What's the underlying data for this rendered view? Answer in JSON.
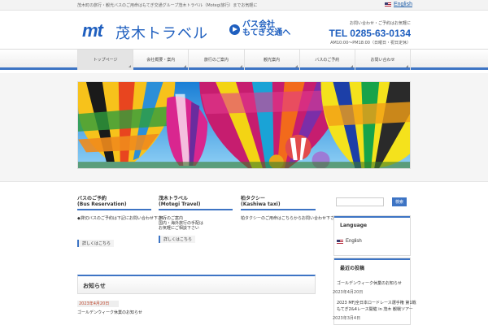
{
  "topbar": {
    "tagline": "茂木町の旅行・観光バスのご用命はもてぎ交通グループ茂木トラベル（Motegi旅行）までお気軽に",
    "language_label": "English"
  },
  "header": {
    "logo_mark": "mt",
    "logo_name": "茂木トラベル",
    "bus_link_line1": "バス会社",
    "bus_link_line2": "もてぎ交通へ",
    "contact_caption": "お問い合わせ・ご予約はお気軽に",
    "tel": "TEL 0285-63-0134",
    "hours": "AM10:00～PM18:00（日曜日・祝日定休）"
  },
  "nav": {
    "items": [
      "トップページ",
      "会社概要・案内",
      "旅行のご案内",
      "観光案内",
      "バスのご予約",
      "お問い合わせ"
    ]
  },
  "services": [
    {
      "title_jp": "バスのご予約",
      "title_en": "(Bus Reservation)",
      "lines": [
        "◆貸切バスのご予約は下記にお問い合わせ下さい"
      ],
      "more": "詳しくはこちら"
    },
    {
      "title_jp": "茂木トラベル",
      "title_en": "(Motegi Travel)",
      "lines": [
        "旅行のご案内",
        "国内・海外旅行の手配は",
        "お気軽にご相談下さい"
      ],
      "more": "詳しくはこちら"
    },
    {
      "title_jp": "柏タクシー",
      "title_en": "(Kashiwa taxi)",
      "lines": [
        "柏タクシーのご用命はこちらからお問い合わせ下さい"
      ],
      "more": ""
    }
  ],
  "news": {
    "heading": "お知らせ",
    "date": "2023年4月20日",
    "title": "ゴールデンウィーク休業のお知らせ"
  },
  "sidebar": {
    "search_button": "検索",
    "language_heading": "Language",
    "language_item": "English",
    "recent_heading": "最近の投稿",
    "posts": [
      {
        "title": "ゴールデンウィーク休業のお知らせ",
        "date": "2023年4月20日"
      },
      {
        "title": "2023 MFJ全日本ロードレース選手権 第1戦",
        "date": ""
      },
      {
        "title": "もてぎ2&4レース開催 in 茂木 観戦ツアー",
        "date": ""
      },
      {
        "title": "",
        "date": "2023年3月4日"
      }
    ]
  },
  "colors": {
    "brand_blue": "#1f5fbf",
    "accent_blue": "#3d74c4",
    "date_red": "#c04a30"
  }
}
